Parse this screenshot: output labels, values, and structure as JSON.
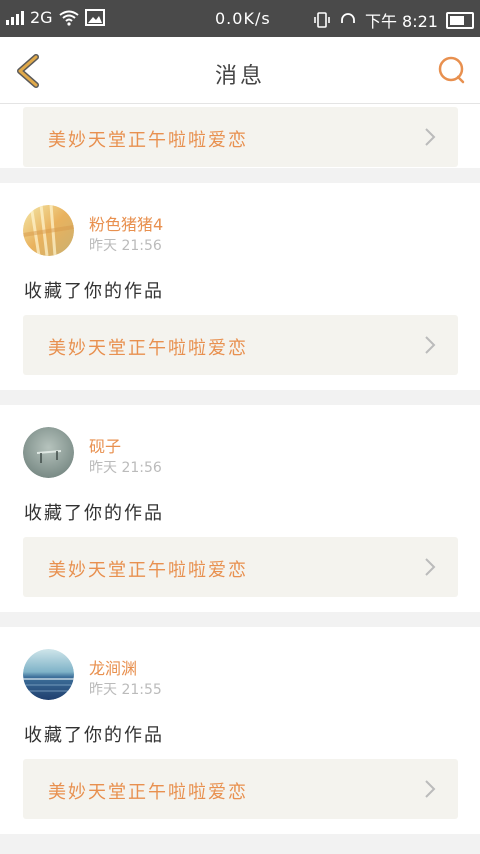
{
  "statusbar": {
    "network": "2G",
    "speed": "0.0K/s",
    "time": "下午 8:21"
  },
  "header": {
    "title": "消息"
  },
  "colors": {
    "accent": "#e8904f",
    "back_arrow": "#e0a94a",
    "card_bg": "#f4f3ee"
  },
  "messages": [
    {
      "work_title": "美妙天堂正午啦啦爱恋"
    },
    {
      "user": "粉色猪猪4",
      "time": "昨天 21:56",
      "action": "收藏了你的作品",
      "work_title": "美妙天堂正午啦啦爱恋"
    },
    {
      "user": "砚子",
      "time": "昨天 21:56",
      "action": "收藏了你的作品",
      "work_title": "美妙天堂正午啦啦爱恋"
    },
    {
      "user": "龙涧渊",
      "time": "昨天 21:55",
      "action": "收藏了你的作品",
      "work_title": "美妙天堂正午啦啦爱恋"
    }
  ]
}
